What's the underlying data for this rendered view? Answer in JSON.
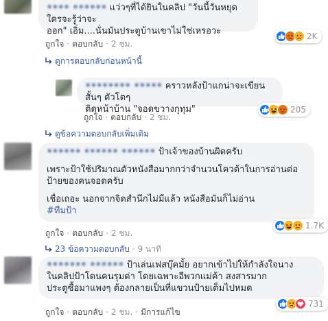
{
  "comments": [
    {
      "name": "•••• ••••••",
      "text": "แว่วๆที่ได้ยินในคลิป \"วันนี้วันหยุด ใครจะรู้ว่าจะ",
      "text2": "ออก\" เอิ่ม....นั่นมันประตูบ้านเขาไม่ใช่เหรอวะ",
      "like": "ถูกใจ",
      "reply": "ตอบกลับ",
      "time": "2 ชม.",
      "reactions": "2K",
      "previous_replies": "ดูการตอบกลับก่อนหน้านี้",
      "nested": {
        "name": "•••••••• •••••",
        "text": "คราวหลังป้าแกน่าจะเขียนสั้นๆ ตัวโตๆ",
        "text2": "ติดหน้าบ้าน \"จอดขวางกุทุม\"",
        "like": "ถูกใจ",
        "reply": "ตอบกลับ",
        "time": "2 ชม.",
        "reactions": "205"
      },
      "more_replies": "ดูข้อความตอบกลับเพิ่มเติม"
    },
    {
      "name": "•••••• •••••• ••••••",
      "line1": "ป้าเจ้าของบ้านผิดครับ",
      "line2": "เพราะป้าใช้ปริมาณตัวหนังสือมากกว่าจำนวนโควต้าในการอ่านต่อ",
      "line3": "ป้ายของคนจอดครับ",
      "line4": "เชื่อเถอะ นอกจากจิตสำนึกไม่มีแล้ว หนังสือมันก็ไม่อ่าน",
      "hashtag": "#ทีมป้า",
      "like": "ถูกใจ",
      "reply": "ตอบกลับ",
      "time": "2 ชม.",
      "reactions": "1.7K",
      "replies_count": "23 ข้อความตอบกลับ",
      "replies_time": "9 นาที"
    },
    {
      "name": "••••••• ••••••",
      "line1": "ป้าเล่นเฟสบุ๊คมั้ย อยากเข้าไปให้กำลังใจนาง",
      "line2": "ในคลิปป้าโดนคนรุมด่า โดยเฉพาะอีพวกแม่ค้า สงสารมาก",
      "line3": "ประตูซื้อมาแพงๆ ต้องกลายเป็นที่แขวนป้ายเต็มไปหมด",
      "like": "ถูกใจ",
      "reply": "ตอบกลับ",
      "time": "2 ชม.",
      "edited": "มีการแก้ไข",
      "reactions": "731"
    }
  ],
  "colors": {
    "link": "#385898",
    "bubble": "#f2f3f5",
    "muted": "#90949c",
    "like_blue": "#1877f2",
    "haha_yellow": "#f7b125",
    "angry_orange": "#e9710f",
    "love_red": "#f33e58"
  },
  "icons": [
    "like-icon",
    "haha-icon",
    "angry-icon",
    "sad-icon",
    "love-icon",
    "reply-arrow-icon"
  ]
}
